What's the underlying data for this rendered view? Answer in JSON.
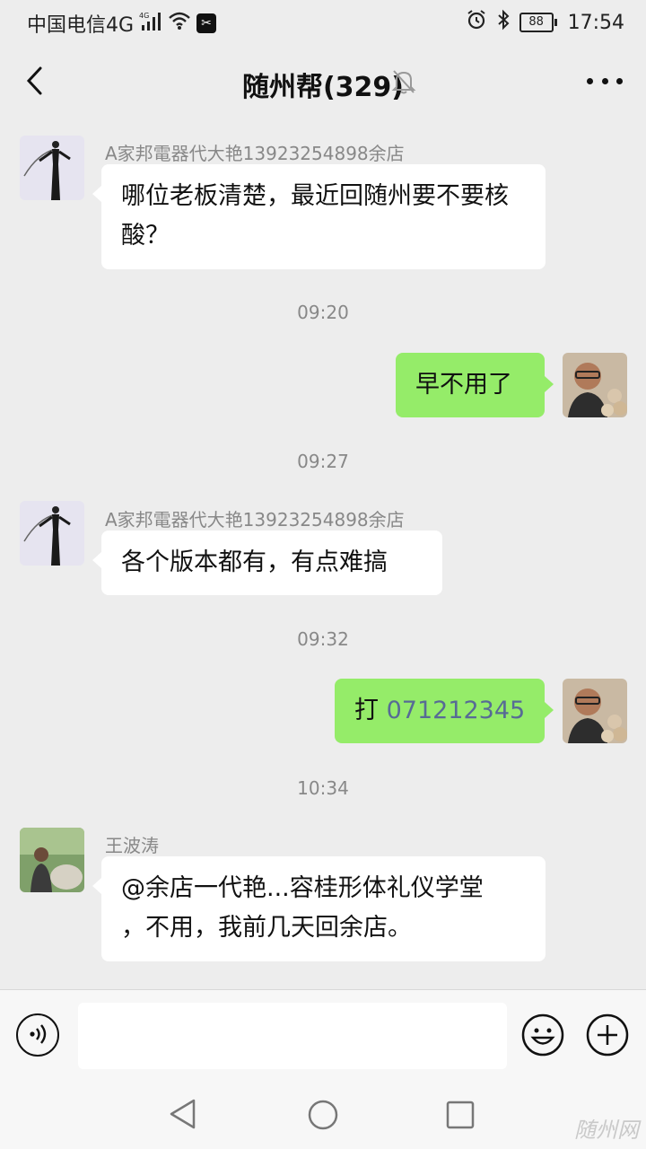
{
  "status_bar": {
    "carrier": "中国电信4G",
    "network_badge": "4G",
    "battery": "88",
    "time": "17:54"
  },
  "header": {
    "title": "随州帮(329)"
  },
  "messages": [
    {
      "sender": "A家邦電器代大艳13923254898余店",
      "text": "哪位老板清楚，最近回随州要不要核酸？"
    },
    {
      "timestamp": "09:20"
    },
    {
      "text": "早不用了"
    },
    {
      "timestamp": "09:27"
    },
    {
      "sender": "A家邦電器代大艳13923254898余店",
      "text": "各个版本都有，有点难搞"
    },
    {
      "timestamp": "09:32"
    },
    {
      "text_prefix": "打 ",
      "phone": "071212345"
    },
    {
      "timestamp": "10:34"
    },
    {
      "sender": "王波涛",
      "text_line1": "@余店一代艳...容桂形体礼仪学堂",
      "text_line2": "，不用，我前几天回余店。"
    }
  ],
  "input": {
    "value": ""
  },
  "watermark": "随州网",
  "colors": {
    "sent_bubble": "#95ec69",
    "received_bubble": "#ffffff",
    "link": "#576b95",
    "background": "#ededed"
  }
}
